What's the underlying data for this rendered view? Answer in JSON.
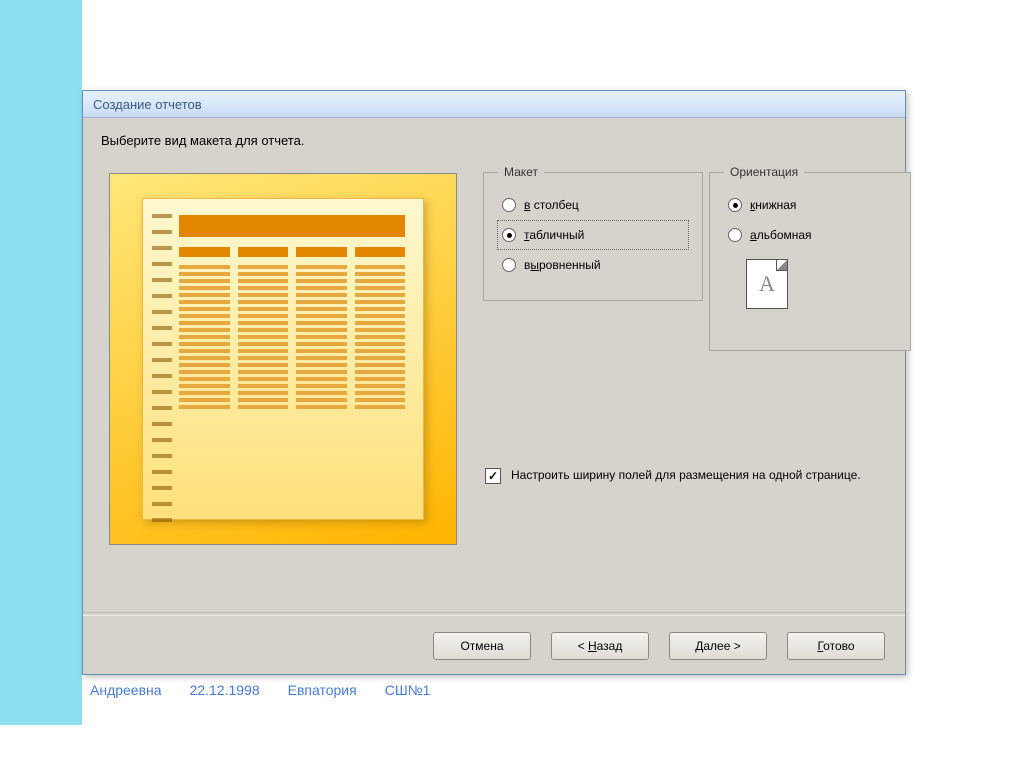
{
  "dialog": {
    "title": "Создание отчетов",
    "instruction": "Выберите вид макета для отчета."
  },
  "layout": {
    "legend": "Макет",
    "options": {
      "columnar": "в столбец",
      "tabular": "табличный",
      "justified": "выровненный"
    },
    "selected": "tabular"
  },
  "orientation": {
    "legend": "Ориентация",
    "options": {
      "portrait": "книжная",
      "landscape": "альбомная"
    },
    "selected": "portrait",
    "preview_glyph": "A"
  },
  "fit_width": {
    "checked": true,
    "label": "Настроить ширину полей для размещения на одной странице."
  },
  "buttons": {
    "cancel": "Отмена",
    "back": "< Назад",
    "next": "Далее >",
    "finish": "Готово"
  },
  "background_row": {
    "col1": "Андреевна",
    "col2": "22.12.1998",
    "col3": "Евпатория",
    "col4": "СШ№1"
  }
}
